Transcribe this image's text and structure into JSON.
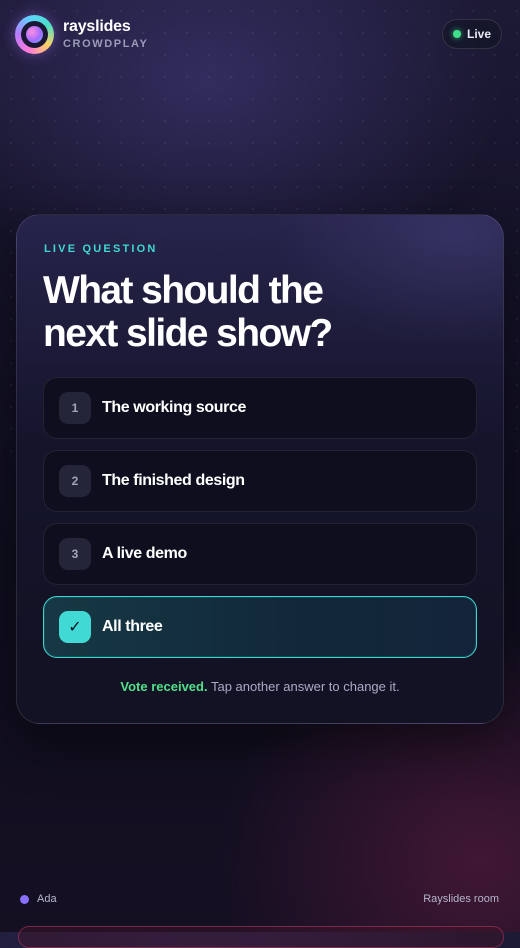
{
  "brand": {
    "name": "rayslides",
    "product": "CROWDPLAY"
  },
  "status": {
    "label": "Live",
    "color": "#3ee08a"
  },
  "card": {
    "eyebrow": "LIVE QUESTION",
    "question_line1": "What should the",
    "question_line2": "next slide show?",
    "options": [
      {
        "number": "1",
        "label": "The working source",
        "selected": false
      },
      {
        "number": "2",
        "label": "The finished design",
        "selected": false
      },
      {
        "number": "3",
        "label": "A live demo",
        "selected": false
      },
      {
        "number": "✓",
        "label": "All three",
        "selected": true
      }
    ],
    "vote_status": "Vote received.",
    "vote_hint": "Tap another answer to change it."
  },
  "footer": {
    "user_name": "Ada",
    "room_name": "Rayslides room"
  },
  "colors": {
    "accent": "#3fd8d2",
    "success": "#52e08a",
    "user_dot": "#8a70ff"
  },
  "icons": {
    "logo": "rayslides-logo-icon",
    "live_status": "status-dot-icon",
    "selected": "check-icon",
    "user": "user-dot-icon"
  }
}
